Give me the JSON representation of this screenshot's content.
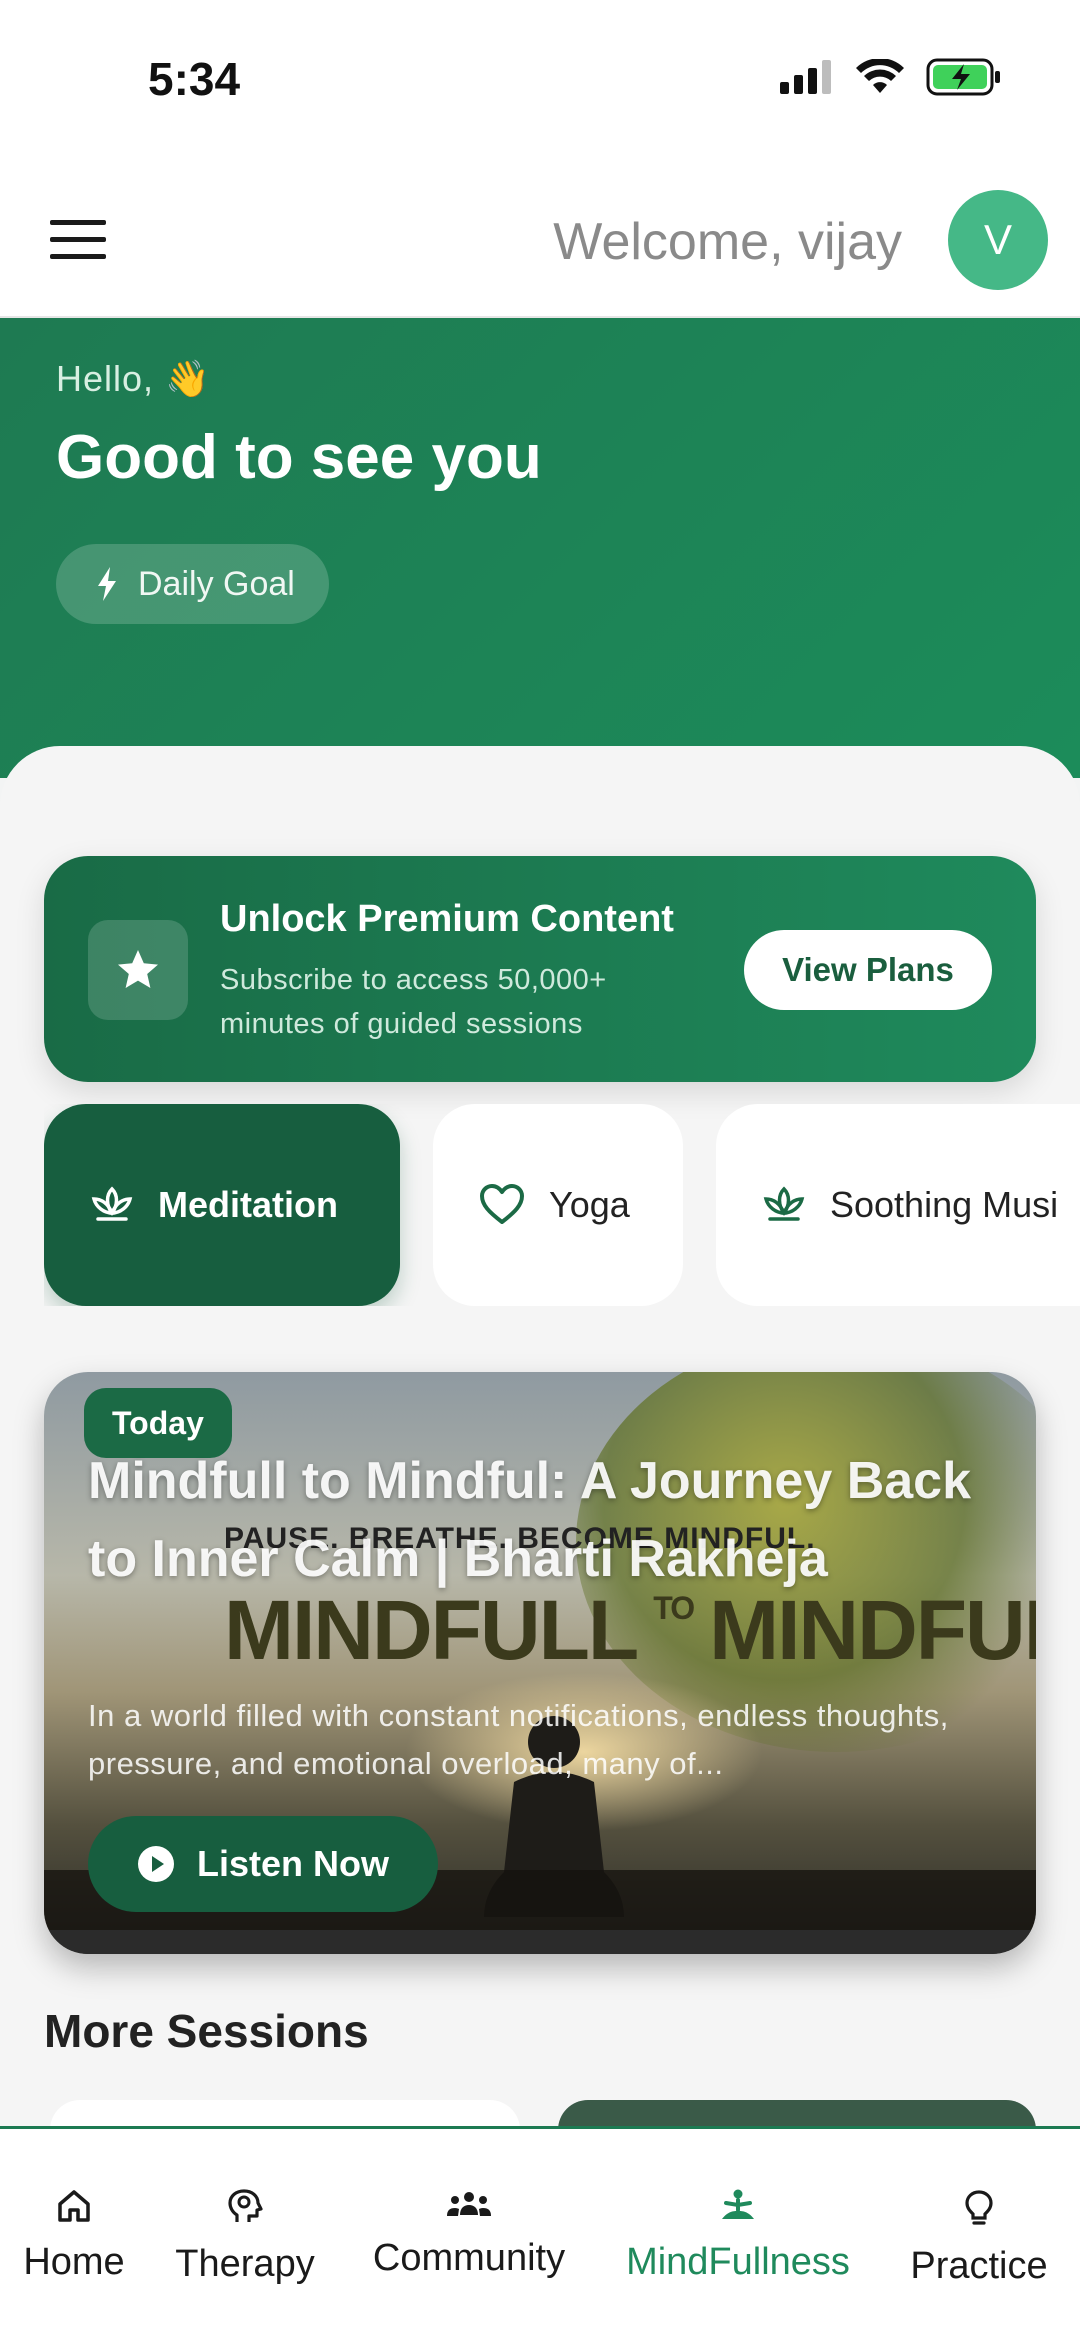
{
  "status_bar": {
    "time": "5:34"
  },
  "header": {
    "welcome": "Welcome, vijay",
    "avatar_initial": "V"
  },
  "hero": {
    "hello": "Hello, 👋",
    "title": "Good to see you",
    "daily_goal_label": "Daily Goal"
  },
  "premium": {
    "title": "Unlock Premium Content",
    "subtitle": "Subscribe to access 50,000+ minutes of guided sessions",
    "button_label": "View Plans"
  },
  "categories": [
    {
      "label": "Meditation",
      "icon": "lotus-icon",
      "active": true
    },
    {
      "label": "Yoga",
      "icon": "heart-icon",
      "active": false
    },
    {
      "label": "Soothing Musi",
      "icon": "lotus-icon",
      "active": false
    }
  ],
  "featured": {
    "badge": "Today",
    "title": "Mindfull to Mindful: A Journey Back to Inner Calm | Bharti Rakheja",
    "description": "In a world filled with constant notifications, endless thoughts, pressure, and emotional overload, many of...",
    "button_label": "Listen Now",
    "thumbnail_line1": "PAUSE. BREATHE. BECOME MINDFUL.",
    "thumbnail_word1": "MINDFULL",
    "thumbnail_to": "TO",
    "thumbnail_word2": "MINDFUL"
  },
  "more_sessions_title": "More Sessions",
  "bottom_nav": [
    {
      "label": "Home",
      "icon": "home-icon",
      "active": false
    },
    {
      "label": "Therapy",
      "icon": "brain-head-icon",
      "active": false
    },
    {
      "label": "Community",
      "icon": "people-icon",
      "active": false
    },
    {
      "label": "MindFullness",
      "icon": "meditation-icon",
      "active": true
    },
    {
      "label": "Practice",
      "icon": "lightbulb-icon",
      "active": false
    }
  ],
  "colors": {
    "primary": "#1c7a52",
    "primary_dark": "#175e3f",
    "avatar": "#45b887",
    "active_nav": "#1f8a5c"
  }
}
